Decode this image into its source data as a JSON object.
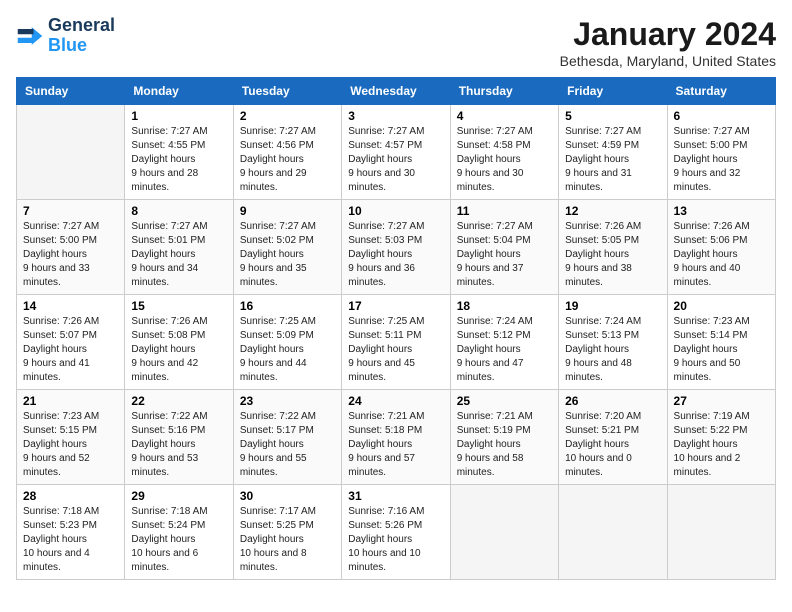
{
  "logo": {
    "line1": "General",
    "line2": "Blue"
  },
  "title": "January 2024",
  "location": "Bethesda, Maryland, United States",
  "days_of_week": [
    "Sunday",
    "Monday",
    "Tuesday",
    "Wednesday",
    "Thursday",
    "Friday",
    "Saturday"
  ],
  "weeks": [
    [
      {
        "num": "",
        "empty": true
      },
      {
        "num": "1",
        "sunrise": "7:27 AM",
        "sunset": "4:55 PM",
        "daylight": "9 hours and 28 minutes."
      },
      {
        "num": "2",
        "sunrise": "7:27 AM",
        "sunset": "4:56 PM",
        "daylight": "9 hours and 29 minutes."
      },
      {
        "num": "3",
        "sunrise": "7:27 AM",
        "sunset": "4:57 PM",
        "daylight": "9 hours and 30 minutes."
      },
      {
        "num": "4",
        "sunrise": "7:27 AM",
        "sunset": "4:58 PM",
        "daylight": "9 hours and 30 minutes."
      },
      {
        "num": "5",
        "sunrise": "7:27 AM",
        "sunset": "4:59 PM",
        "daylight": "9 hours and 31 minutes."
      },
      {
        "num": "6",
        "sunrise": "7:27 AM",
        "sunset": "5:00 PM",
        "daylight": "9 hours and 32 minutes."
      }
    ],
    [
      {
        "num": "7",
        "sunrise": "7:27 AM",
        "sunset": "5:00 PM",
        "daylight": "9 hours and 33 minutes."
      },
      {
        "num": "8",
        "sunrise": "7:27 AM",
        "sunset": "5:01 PM",
        "daylight": "9 hours and 34 minutes."
      },
      {
        "num": "9",
        "sunrise": "7:27 AM",
        "sunset": "5:02 PM",
        "daylight": "9 hours and 35 minutes."
      },
      {
        "num": "10",
        "sunrise": "7:27 AM",
        "sunset": "5:03 PM",
        "daylight": "9 hours and 36 minutes."
      },
      {
        "num": "11",
        "sunrise": "7:27 AM",
        "sunset": "5:04 PM",
        "daylight": "9 hours and 37 minutes."
      },
      {
        "num": "12",
        "sunrise": "7:26 AM",
        "sunset": "5:05 PM",
        "daylight": "9 hours and 38 minutes."
      },
      {
        "num": "13",
        "sunrise": "7:26 AM",
        "sunset": "5:06 PM",
        "daylight": "9 hours and 40 minutes."
      }
    ],
    [
      {
        "num": "14",
        "sunrise": "7:26 AM",
        "sunset": "5:07 PM",
        "daylight": "9 hours and 41 minutes."
      },
      {
        "num": "15",
        "sunrise": "7:26 AM",
        "sunset": "5:08 PM",
        "daylight": "9 hours and 42 minutes."
      },
      {
        "num": "16",
        "sunrise": "7:25 AM",
        "sunset": "5:09 PM",
        "daylight": "9 hours and 44 minutes."
      },
      {
        "num": "17",
        "sunrise": "7:25 AM",
        "sunset": "5:11 PM",
        "daylight": "9 hours and 45 minutes."
      },
      {
        "num": "18",
        "sunrise": "7:24 AM",
        "sunset": "5:12 PM",
        "daylight": "9 hours and 47 minutes."
      },
      {
        "num": "19",
        "sunrise": "7:24 AM",
        "sunset": "5:13 PM",
        "daylight": "9 hours and 48 minutes."
      },
      {
        "num": "20",
        "sunrise": "7:23 AM",
        "sunset": "5:14 PM",
        "daylight": "9 hours and 50 minutes."
      }
    ],
    [
      {
        "num": "21",
        "sunrise": "7:23 AM",
        "sunset": "5:15 PM",
        "daylight": "9 hours and 52 minutes."
      },
      {
        "num": "22",
        "sunrise": "7:22 AM",
        "sunset": "5:16 PM",
        "daylight": "9 hours and 53 minutes."
      },
      {
        "num": "23",
        "sunrise": "7:22 AM",
        "sunset": "5:17 PM",
        "daylight": "9 hours and 55 minutes."
      },
      {
        "num": "24",
        "sunrise": "7:21 AM",
        "sunset": "5:18 PM",
        "daylight": "9 hours and 57 minutes."
      },
      {
        "num": "25",
        "sunrise": "7:21 AM",
        "sunset": "5:19 PM",
        "daylight": "9 hours and 58 minutes."
      },
      {
        "num": "26",
        "sunrise": "7:20 AM",
        "sunset": "5:21 PM",
        "daylight": "10 hours and 0 minutes."
      },
      {
        "num": "27",
        "sunrise": "7:19 AM",
        "sunset": "5:22 PM",
        "daylight": "10 hours and 2 minutes."
      }
    ],
    [
      {
        "num": "28",
        "sunrise": "7:18 AM",
        "sunset": "5:23 PM",
        "daylight": "10 hours and 4 minutes."
      },
      {
        "num": "29",
        "sunrise": "7:18 AM",
        "sunset": "5:24 PM",
        "daylight": "10 hours and 6 minutes."
      },
      {
        "num": "30",
        "sunrise": "7:17 AM",
        "sunset": "5:25 PM",
        "daylight": "10 hours and 8 minutes."
      },
      {
        "num": "31",
        "sunrise": "7:16 AM",
        "sunset": "5:26 PM",
        "daylight": "10 hours and 10 minutes."
      },
      {
        "num": "",
        "empty": true
      },
      {
        "num": "",
        "empty": true
      },
      {
        "num": "",
        "empty": true
      }
    ]
  ],
  "labels": {
    "sunrise": "Sunrise:",
    "sunset": "Sunset:",
    "daylight": "Daylight hours"
  }
}
